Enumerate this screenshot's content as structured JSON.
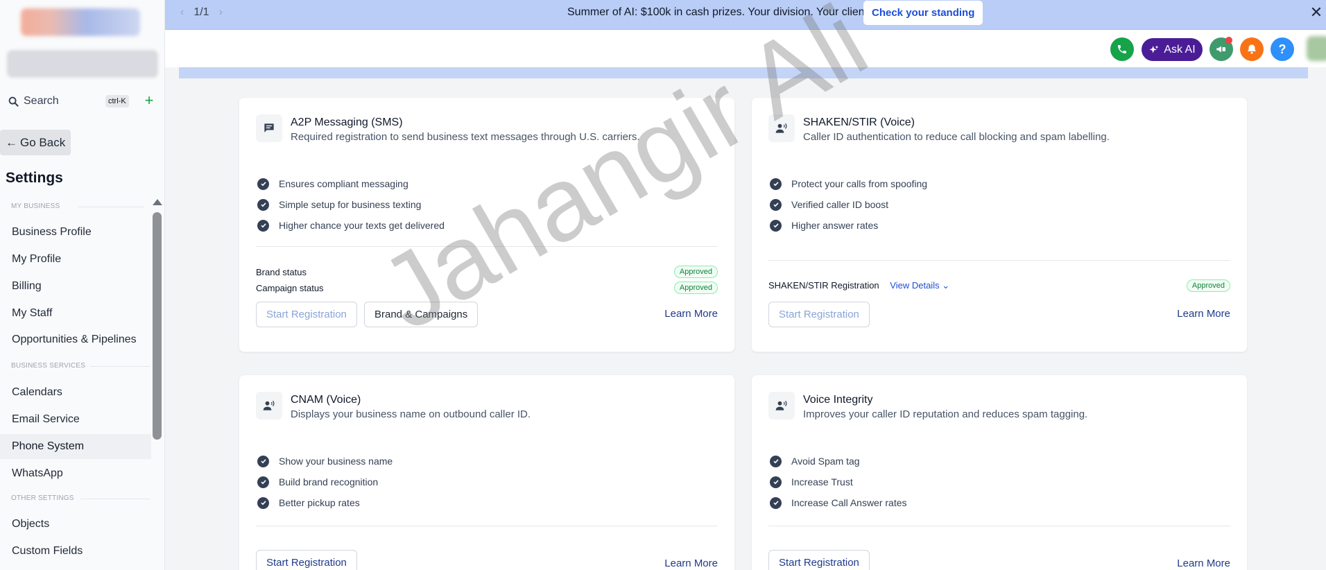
{
  "sidebar": {
    "search_label": "Search",
    "search_shortcut": "ctrl-K",
    "add_label": "+",
    "go_back_label": "Go Back",
    "title": "Settings",
    "sections": {
      "my_business": "MY BUSINESS",
      "business_services": "BUSINESS SERVICES",
      "other_settings": "OTHER SETTINGS"
    },
    "items": [
      {
        "label": "Business Profile"
      },
      {
        "label": "My Profile"
      },
      {
        "label": "Billing"
      },
      {
        "label": "My Staff"
      },
      {
        "label": "Opportunities & Pipelines"
      },
      {
        "label": "Calendars"
      },
      {
        "label": "Email Service"
      },
      {
        "label": "Phone System"
      },
      {
        "label": "WhatsApp"
      },
      {
        "label": "Objects"
      },
      {
        "label": "Custom Fields"
      }
    ],
    "active_item": "Phone System"
  },
  "banner": {
    "pager": "1/1",
    "message": "Summer of AI: $100k in cash prizes. Your division. Your clients.",
    "cta": "Check your standing",
    "close": "✕"
  },
  "topbar": {
    "ask_ai": "Ask AI",
    "help": "?",
    "colors": {
      "phone": "#16a34a",
      "ask_ai": "#4a1d96",
      "megaphone": "#3f9b6b",
      "bell": "#f97316",
      "help": "#2e90fa"
    }
  },
  "cards": {
    "a2p": {
      "title": "A2P Messaging (SMS)",
      "subtitle": "Required registration to send business text messages through U.S. carriers.",
      "features": [
        "Ensures compliant messaging",
        "Simple setup for business texting",
        "Higher chance your texts get delivered"
      ],
      "brand_status_label": "Brand status",
      "brand_status": "Approved",
      "campaign_status_label": "Campaign status",
      "campaign_status": "Approved",
      "start_registration": "Start Registration",
      "brand_campaigns": "Brand & Campaigns",
      "learn_more": "Learn More"
    },
    "shaken": {
      "title": "SHAKEN/STIR (Voice)",
      "subtitle": "Caller ID authentication to reduce call blocking and spam labelling.",
      "features": [
        "Protect your calls from spoofing",
        "Verified caller ID boost",
        "Higher answer rates"
      ],
      "registration_label": "SHAKEN/STIR Registration",
      "view_details": "View Details",
      "status": "Approved",
      "start_registration": "Start Registration",
      "learn_more": "Learn More"
    },
    "cnam": {
      "title": "CNAM (Voice)",
      "subtitle": "Displays your business name on outbound caller ID.",
      "features": [
        "Show your business name",
        "Build brand recognition",
        "Better pickup rates"
      ],
      "start_registration": "Start Registration",
      "learn_more": "Learn More"
    },
    "voice_integrity": {
      "title": "Voice Integrity",
      "subtitle": "Improves your caller ID reputation and reduces spam tagging.",
      "features": [
        "Avoid Spam tag",
        "Increase Trust",
        "Increase Call Answer rates"
      ],
      "start_registration": "Start Registration",
      "learn_more": "Learn More"
    }
  },
  "watermark": "Jahangir Ali"
}
